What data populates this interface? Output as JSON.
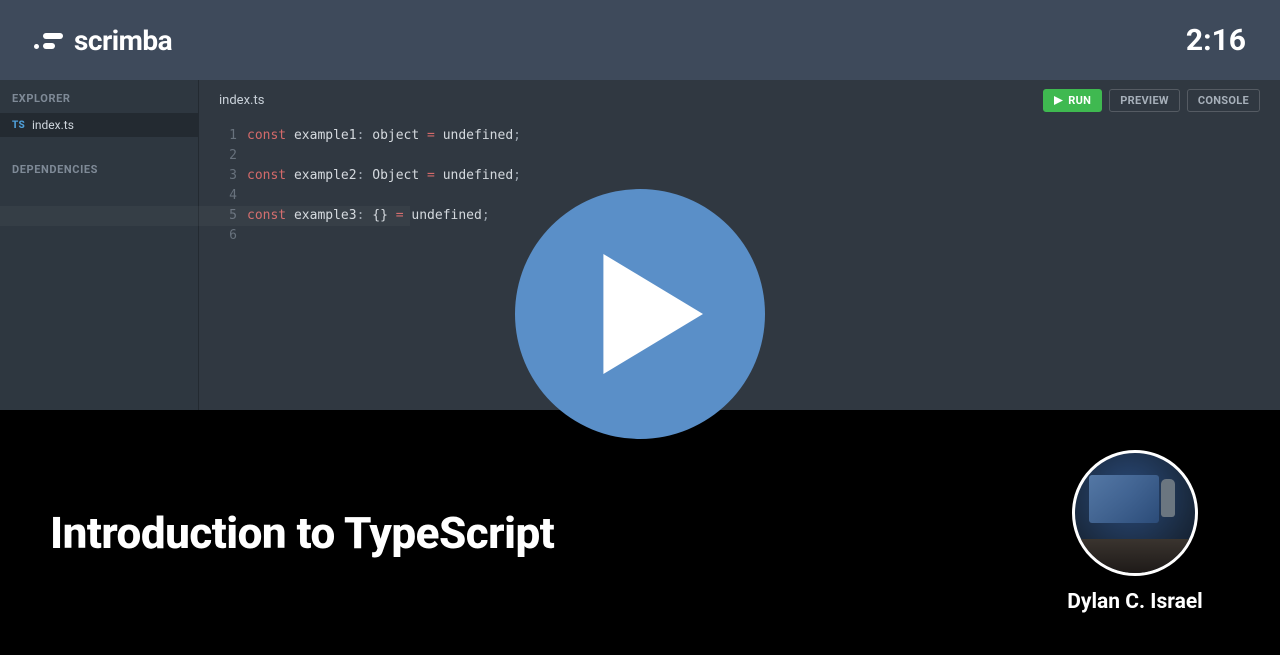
{
  "brand": {
    "name": "scrimba"
  },
  "time": "2:16",
  "sidebar": {
    "explorer_label": "EXPLORER",
    "dependencies_label": "DEPENDENCIES",
    "file": {
      "badge": "TS",
      "name": "index.ts"
    }
  },
  "editor": {
    "active_tab": "index.ts",
    "toolbar": {
      "run": "RUN",
      "preview": "PREVIEW",
      "console": "CONSOLE"
    },
    "line_numbers": [
      "1",
      "2",
      "3",
      "4",
      "5",
      "6"
    ],
    "active_line_index": 4,
    "code": {
      "lines": [
        [
          {
            "t": "const ",
            "c": "kw"
          },
          {
            "t": "example1",
            "c": "ident"
          },
          {
            "t": ": ",
            "c": "punc"
          },
          {
            "t": "object ",
            "c": "type"
          },
          {
            "t": "= ",
            "c": "op"
          },
          {
            "t": "undefined",
            "c": "ident"
          },
          {
            "t": ";",
            "c": "punc"
          }
        ],
        [],
        [
          {
            "t": "const ",
            "c": "kw"
          },
          {
            "t": "example2",
            "c": "ident"
          },
          {
            "t": ": ",
            "c": "punc"
          },
          {
            "t": "Object ",
            "c": "type"
          },
          {
            "t": "= ",
            "c": "op"
          },
          {
            "t": "undefined",
            "c": "ident"
          },
          {
            "t": ";",
            "c": "punc"
          }
        ],
        [],
        [
          {
            "t": "const ",
            "c": "kw"
          },
          {
            "t": "example3",
            "c": "ident"
          },
          {
            "t": ": ",
            "c": "punc"
          },
          {
            "t": "{} ",
            "c": "type"
          },
          {
            "t": "= ",
            "c": "op"
          },
          {
            "t": "undefined",
            "c": "ident"
          },
          {
            "t": ";",
            "c": "punc"
          }
        ],
        []
      ]
    }
  },
  "hero": {
    "title": "Introduction to TypeScript",
    "instructor": "Dylan C. Israel"
  }
}
